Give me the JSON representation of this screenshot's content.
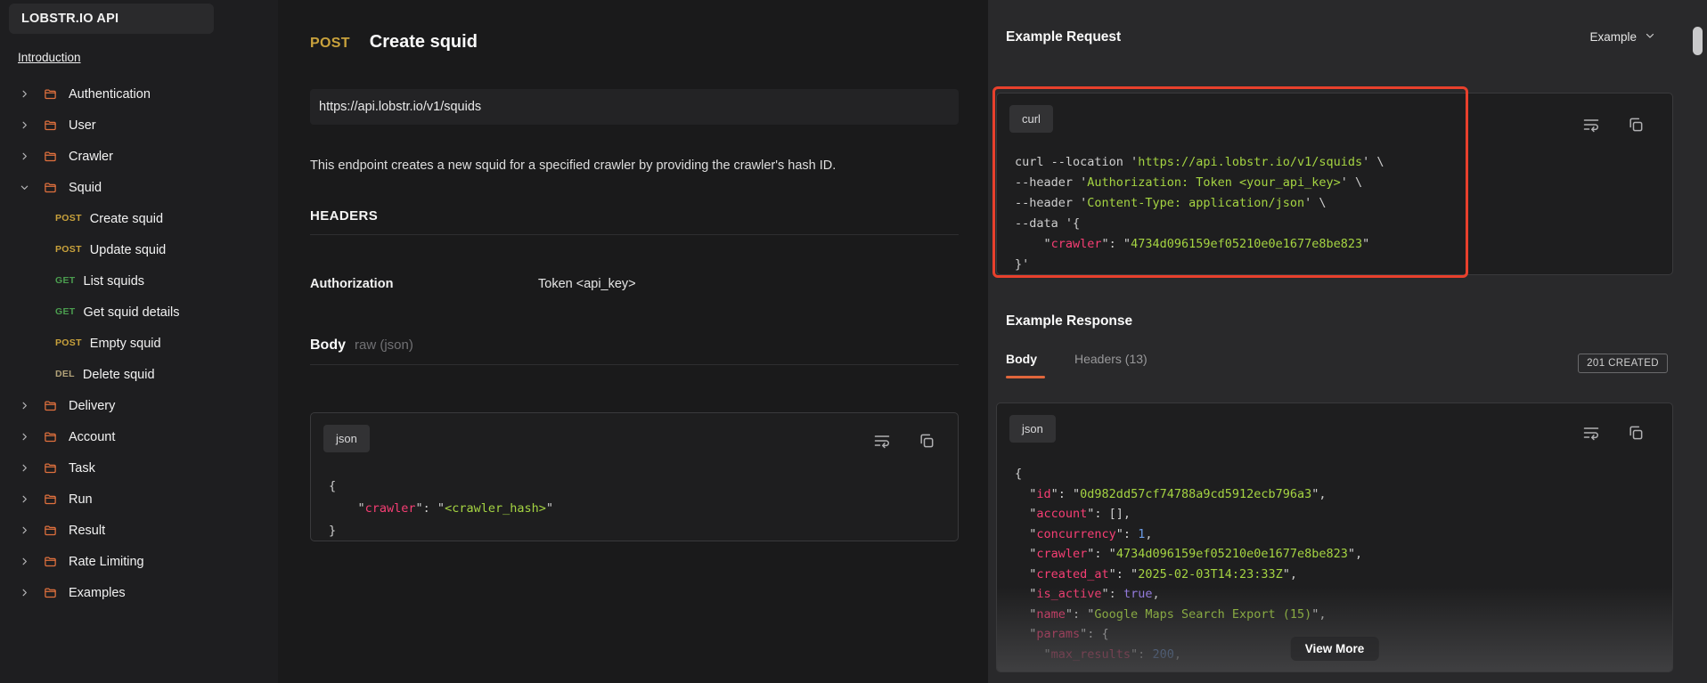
{
  "sidebar": {
    "title": "LOBSTR.IO API",
    "intro_link": "Introduction",
    "items": [
      {
        "label": "Authentication",
        "expanded": false
      },
      {
        "label": "User",
        "expanded": false
      },
      {
        "label": "Crawler",
        "expanded": false
      },
      {
        "label": "Squid",
        "expanded": true,
        "children": [
          {
            "method": "POST",
            "label": "Create squid"
          },
          {
            "method": "POST",
            "label": "Update squid"
          },
          {
            "method": "GET",
            "label": "List squids"
          },
          {
            "method": "GET",
            "label": "Get squid details"
          },
          {
            "method": "POST",
            "label": "Empty squid"
          },
          {
            "method": "DEL",
            "label": "Delete squid"
          }
        ]
      },
      {
        "label": "Delivery",
        "expanded": false
      },
      {
        "label": "Account",
        "expanded": false
      },
      {
        "label": "Task",
        "expanded": false
      },
      {
        "label": "Run",
        "expanded": false
      },
      {
        "label": "Result",
        "expanded": false
      },
      {
        "label": "Rate Limiting",
        "expanded": false
      },
      {
        "label": "Examples",
        "expanded": false
      }
    ],
    "method_colors": {
      "POST": "#c9a23c",
      "GET": "#4b9e4f",
      "DEL": "#b3a379",
      "folder": "#e0703d"
    }
  },
  "main": {
    "method": "POST",
    "title": "Create squid",
    "url": "https://api.lobstr.io/v1/squids",
    "description": "This endpoint creates a new squid for a specified crawler by providing the crawler's hash ID.",
    "headers_section": {
      "title": "HEADERS",
      "rows": [
        {
          "key": "Authorization",
          "value": "Token <api_key>"
        }
      ]
    },
    "body_section": {
      "label": "Body",
      "subtitle": "raw (json)",
      "language": "json",
      "code": [
        [
          {
            "t": "{",
            "c": "plain"
          }
        ],
        [
          {
            "t": "    \"",
            "c": "plain"
          },
          {
            "t": "crawler",
            "c": "key"
          },
          {
            "t": "\": \"",
            "c": "plain"
          },
          {
            "t": "<crawler_hash>",
            "c": "str"
          },
          {
            "t": "\"",
            "c": "plain"
          }
        ],
        [
          {
            "t": "}",
            "c": "plain"
          }
        ]
      ]
    }
  },
  "request_panel": {
    "title": "Example Request",
    "dropdown_label": "Example",
    "language": "curl",
    "highlight_color": "#e8402c",
    "code": [
      [
        {
          "t": "curl --location ",
          "c": "plain"
        },
        {
          "t": "'",
          "c": "plain"
        },
        {
          "t": "https://api.lobstr.io/v1/squids",
          "c": "str"
        },
        {
          "t": "' \\",
          "c": "plain"
        }
      ],
      [
        {
          "t": "--header ",
          "c": "plain"
        },
        {
          "t": "'",
          "c": "plain"
        },
        {
          "t": "Authorization: Token <your_api_key>",
          "c": "str"
        },
        {
          "t": "' \\",
          "c": "plain"
        }
      ],
      [
        {
          "t": "--header ",
          "c": "plain"
        },
        {
          "t": "'",
          "c": "plain"
        },
        {
          "t": "Content-Type: application/json",
          "c": "str"
        },
        {
          "t": "' \\",
          "c": "plain"
        }
      ],
      [
        {
          "t": "--data ",
          "c": "plain"
        },
        {
          "t": "'{",
          "c": "plain"
        }
      ],
      [
        {
          "t": "    \"",
          "c": "plain"
        },
        {
          "t": "crawler",
          "c": "key"
        },
        {
          "t": "\": \"",
          "c": "plain"
        },
        {
          "t": "4734d096159ef05210e0e1677e8be823",
          "c": "str"
        },
        {
          "t": "\"",
          "c": "plain"
        }
      ],
      [
        {
          "t": "}'",
          "c": "plain"
        }
      ]
    ]
  },
  "response_panel": {
    "title": "Example Response",
    "tabs": [
      {
        "label": "Body",
        "active": true
      },
      {
        "label": "Headers (13)",
        "active": false
      }
    ],
    "status_badge": "201 CREATED",
    "language": "json",
    "view_more_label": "View More",
    "accent_color": "#e0663c",
    "code": [
      [
        {
          "t": "{",
          "c": "plain"
        }
      ],
      [
        {
          "t": "  \"",
          "c": "plain"
        },
        {
          "t": "id",
          "c": "key"
        },
        {
          "t": "\": \"",
          "c": "plain"
        },
        {
          "t": "0d982dd57cf74788a9cd5912ecb796a3",
          "c": "str"
        },
        {
          "t": "\",",
          "c": "plain"
        }
      ],
      [
        {
          "t": "  \"",
          "c": "plain"
        },
        {
          "t": "account",
          "c": "key"
        },
        {
          "t": "\": [],",
          "c": "plain"
        }
      ],
      [
        {
          "t": "  \"",
          "c": "plain"
        },
        {
          "t": "concurrency",
          "c": "key"
        },
        {
          "t": "\": ",
          "c": "plain"
        },
        {
          "t": "1",
          "c": "num"
        },
        {
          "t": ",",
          "c": "plain"
        }
      ],
      [
        {
          "t": "  \"",
          "c": "plain"
        },
        {
          "t": "crawler",
          "c": "key"
        },
        {
          "t": "\": \"",
          "c": "plain"
        },
        {
          "t": "4734d096159ef05210e0e1677e8be823",
          "c": "str"
        },
        {
          "t": "\",",
          "c": "plain"
        }
      ],
      [
        {
          "t": "  \"",
          "c": "plain"
        },
        {
          "t": "created_at",
          "c": "key"
        },
        {
          "t": "\": \"",
          "c": "plain"
        },
        {
          "t": "2025-02-03T14:23:33Z",
          "c": "str"
        },
        {
          "t": "\",",
          "c": "plain"
        }
      ],
      [
        {
          "t": "  \"",
          "c": "plain"
        },
        {
          "t": "is_active",
          "c": "key"
        },
        {
          "t": "\": ",
          "c": "plain"
        },
        {
          "t": "true",
          "c": "bool"
        },
        {
          "t": ",",
          "c": "plain"
        }
      ],
      [
        {
          "t": "  \"",
          "c": "plain"
        },
        {
          "t": "name",
          "c": "key"
        },
        {
          "t": "\": \"",
          "c": "plain"
        },
        {
          "t": "Google Maps Search Export (15)",
          "c": "str"
        },
        {
          "t": "\",",
          "c": "plain"
        }
      ],
      [
        {
          "t": "  \"",
          "c": "plain"
        },
        {
          "t": "params",
          "c": "key"
        },
        {
          "t": "\": {",
          "c": "plain"
        }
      ],
      [
        {
          "t": "    \"",
          "c": "plain"
        },
        {
          "t": "max_results",
          "c": "key"
        },
        {
          "t": "\": ",
          "c": "plain"
        },
        {
          "t": "200",
          "c": "num"
        },
        {
          "t": ",",
          "c": "plain"
        }
      ]
    ]
  }
}
